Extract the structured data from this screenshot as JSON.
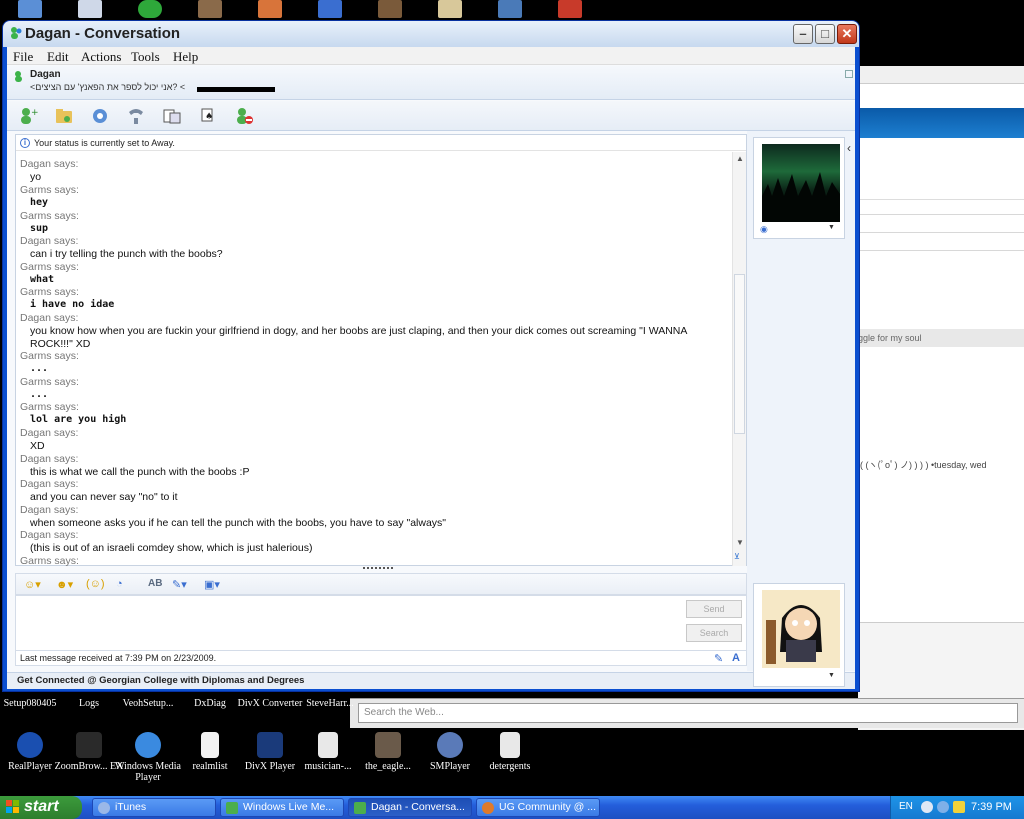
{
  "window": {
    "title": "Dagan - Conversation",
    "minimize": "–",
    "maximize": "□",
    "close": "✕"
  },
  "menu": [
    "File",
    "Edit",
    "Actions",
    "Tools",
    "Help"
  ],
  "contact": {
    "name": "Dagan",
    "personal_message": "<אני יכול לספר את הפאנץ' עם הציצים? <"
  },
  "status_note": "Your status is currently set to Away.",
  "messages": [
    {
      "sender": "Dagan says:",
      "text": "yo",
      "style": "d"
    },
    {
      "sender": "Garms says:",
      "text": "hey",
      "style": "g"
    },
    {
      "sender": "Garms says:",
      "text": "sup",
      "style": "g"
    },
    {
      "sender": "Dagan says:",
      "text": "can i try telling the punch with the boobs?",
      "style": "d"
    },
    {
      "sender": "Garms says:",
      "text": "what",
      "style": "g"
    },
    {
      "sender": "Garms says:",
      "text": "i have no idae",
      "style": "g"
    },
    {
      "sender": "Dagan says:",
      "text": "you know how when you are fuckin your girlfriend in dogy, and her boobs are just claping, and then your dick comes out screaming \"I WANNA ROCK!!!\" XD",
      "style": "d"
    },
    {
      "sender": "Garms says:",
      "text": "...",
      "style": "g"
    },
    {
      "sender": "Garms says:",
      "text": "...",
      "style": "g"
    },
    {
      "sender": "Garms says:",
      "text": "lol are you high",
      "style": "g"
    },
    {
      "sender": "Dagan says:",
      "text": "XD",
      "style": "d"
    },
    {
      "sender": "Dagan says:",
      "text": "this is what we call the punch with the boobs :P",
      "style": "d"
    },
    {
      "sender": "Dagan says:",
      "text": "and you can never say \"no\" to it",
      "style": "d"
    },
    {
      "sender": "Dagan says:",
      "text": "when someone asks you if he can tell the punch with the boobs, you have to say \"always\"",
      "style": "d"
    },
    {
      "sender": "Dagan says:",
      "text": "(this is out of an israeli comdey show, which is just halerious)",
      "style": "d"
    },
    {
      "sender": "Garms says:",
      "text": "",
      "style": "g"
    }
  ],
  "format_toolbar": {
    "emoticon": "☺▾",
    "wink": "☻▾",
    "nudge": "(☺)",
    "voice_clip": "◔",
    "font": "AB",
    "background": "✎▾",
    "games": "▣▾"
  },
  "buttons": {
    "send": "Send",
    "search": "Search"
  },
  "last_message": "Last message received at 7:39 PM on 2/23/2009.",
  "footer_ad": "Get Connected @ Georgian College with Diplomas and Degrees",
  "background_window": {
    "side_text": "ggle for my soul",
    "emote_line": "( (ヽ(ﾟoﾟ) ノ) ) ) ) •tuesday, wed",
    "search_placeholder": "Search the Web..."
  },
  "desktop_row1": [
    "Setup080405",
    "Logs",
    "VeohSetup...",
    "DxDiag",
    "DivX Converter",
    "SteveHarr..."
  ],
  "desktop_row2": [
    "RealPlayer",
    "ZoomBrow... EX",
    "Windows Media Player",
    "realmlist",
    "DivX Player",
    "musician-...",
    "the_eagle...",
    "SMPlayer",
    "detergents"
  ],
  "taskbar": {
    "start": "start",
    "tasks": [
      "iTunes",
      "Windows Live Me...",
      "Dagan - Conversa...",
      "UG Community @ ..."
    ],
    "lang": "EN",
    "clock": "7:39 PM"
  },
  "colors": {
    "xp_blue": "#245edb",
    "start_green": "#2d7e2d",
    "msn_bg": "#f7f9fc"
  }
}
